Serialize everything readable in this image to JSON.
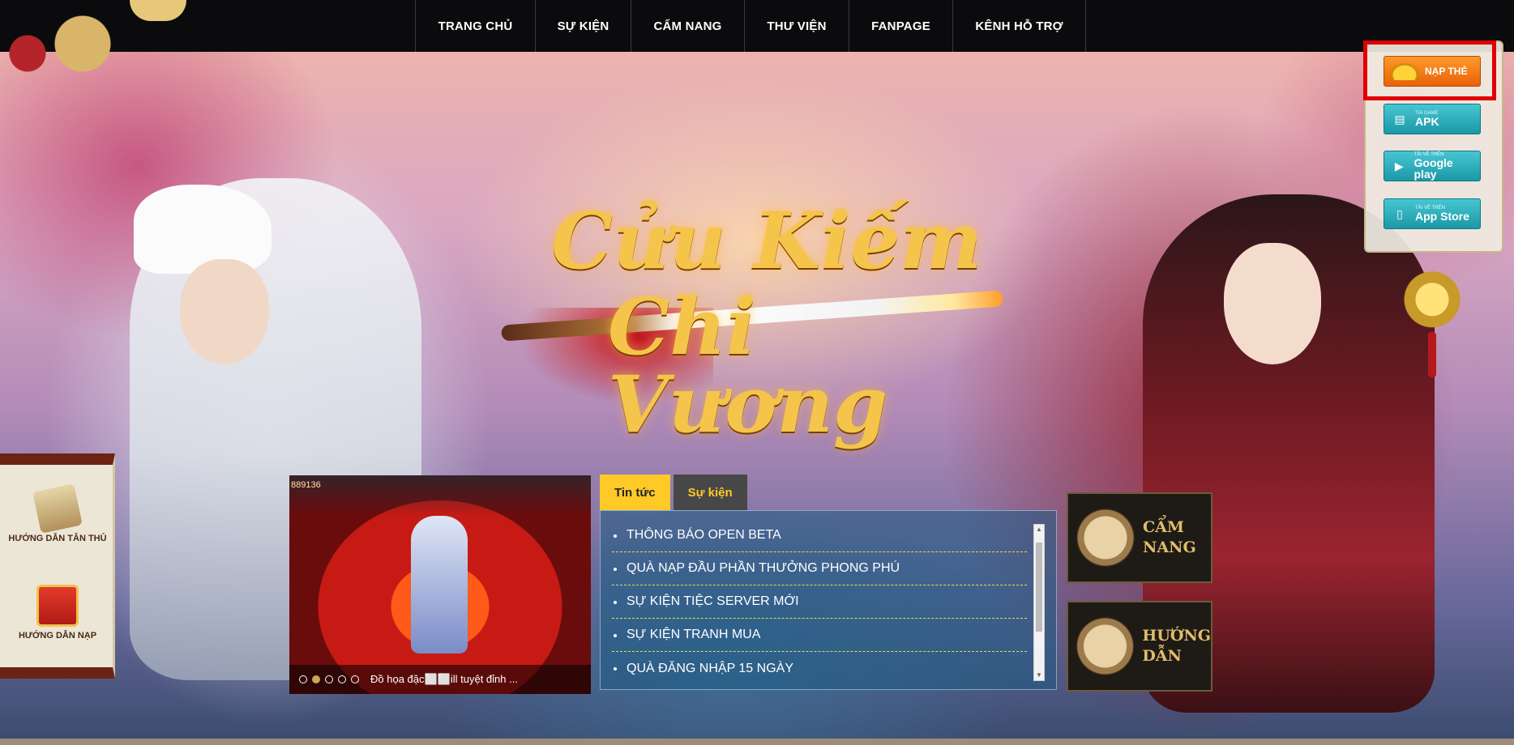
{
  "nav": {
    "items": [
      "TRANG CHỦ",
      "SỰ KIỆN",
      "CẨM NANG",
      "THƯ VIỆN",
      "FANPAGE",
      "KÊNH HỖ TRỢ"
    ]
  },
  "side_panel": {
    "nap_the": "NẠP THẺ",
    "apk_small": "TẢI GAME",
    "apk_big": "APK",
    "google_small": "TẢI VỀ TRÊN",
    "google_big": "Google play",
    "apple_small": "TẢI VỀ TRÊN",
    "apple_big": "App Store"
  },
  "logo": {
    "line1": "Cửu Kiếm",
    "line2": "Chi Vương"
  },
  "left_scroll": {
    "item1": "HƯỚNG DẪN TÂN THỦ",
    "item2": "HƯỚNG DẪN NẠP"
  },
  "video": {
    "score": "889136",
    "caption": "Đồ họa đặc⬜⬜ill tuyệt đỉnh ...",
    "active_dot": 1
  },
  "news": {
    "tabs": [
      "Tin tức",
      "Sự kiện"
    ],
    "items": [
      "THÔNG BÁO OPEN BETA",
      "QUÀ NẠP ĐẦU PHẦN THƯỞNG PHONG PHÚ",
      "SỰ KIỆN TIỆC SERVER MỚI",
      "SỰ KIỆN TRANH MUA",
      "QUÀ ĐĂNG NHẬP 15 NGÀY"
    ]
  },
  "tiles": {
    "cam_nang_1": "CẨM",
    "cam_nang_2": "NANG",
    "huong_dan_1": "HƯỚNG",
    "huong_dan_2": "DẪN"
  },
  "colors": {
    "highlight": "#e00000",
    "tab_active": "#ffc928",
    "nap_button": "#e8620a",
    "store_button": "#1c98a6"
  }
}
